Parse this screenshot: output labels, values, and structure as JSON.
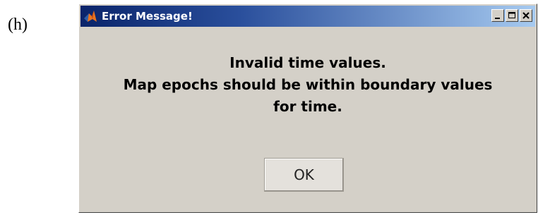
{
  "figure_label": "(h)",
  "window": {
    "title": "Error Message!",
    "icon": "matlab-icon",
    "title_gradient": [
      "#0a246a",
      "#a6caf0"
    ],
    "controls": [
      "minimize-icon",
      "maximize-icon",
      "close-icon"
    ]
  },
  "message": {
    "line1": "Invalid time values.",
    "line2": "Map epochs should be within boundary values",
    "line3": "for time."
  },
  "ok_button": {
    "label": "OK"
  }
}
